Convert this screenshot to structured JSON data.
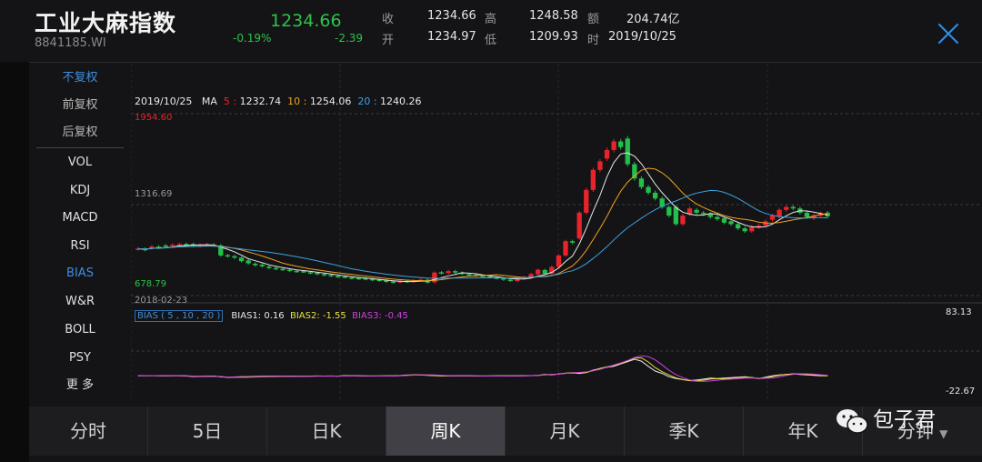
{
  "header": {
    "title": "工业大麻指数",
    "code": "8841185.WI",
    "price": "1234.66",
    "change_pct": "-0.19%",
    "change": "-2.39",
    "quotes": [
      {
        "label": "收",
        "value": "1234.66"
      },
      {
        "label": "开",
        "value": "1234.97"
      },
      {
        "label": "高",
        "value": "1248.58"
      },
      {
        "label": "低",
        "value": "1209.93"
      },
      {
        "label": "额",
        "value": "204.74亿"
      },
      {
        "label": "时",
        "value": "2019/10/25"
      }
    ]
  },
  "sidebar": {
    "items": [
      {
        "label": "不复权",
        "active": true
      },
      {
        "label": "前复权"
      },
      {
        "label": "后复权"
      },
      {
        "label": "VOL"
      },
      {
        "label": "KDJ"
      },
      {
        "label": "MACD"
      },
      {
        "label": "RSI"
      },
      {
        "label": "BIAS",
        "active": true
      },
      {
        "label": "W&R"
      },
      {
        "label": "BOLL"
      },
      {
        "label": "PSY"
      },
      {
        "label": "更 多"
      }
    ]
  },
  "ma_legend": {
    "date": "2019/10/25",
    "ma": "MA",
    "ma5_label": "5 :",
    "ma5": "1232.74",
    "ma10_label": "10 :",
    "ma10": "1254.06",
    "ma20_label": "20 :",
    "ma20": "1240.26"
  },
  "axis_labels": {
    "high": "1954.60",
    "mid": "1316.69",
    "low": "678.79",
    "start_date": "2018-02-23",
    "bias_top": "83.13",
    "bias_bottom": "-22.67"
  },
  "bias_legend": {
    "box": "BIAS ( 5 , 10 , 20 )",
    "bias1": "BIAS1: 0.16",
    "bias2": "BIAS2: -1.55",
    "bias3": "BIAS3: -0.45"
  },
  "tabs": [
    {
      "label": "分时"
    },
    {
      "label": "5日"
    },
    {
      "label": "日K"
    },
    {
      "label": "周K",
      "active": true
    },
    {
      "label": "月K"
    },
    {
      "label": "季K"
    },
    {
      "label": "年K"
    },
    {
      "label": "分钟"
    }
  ],
  "watermark": "包子君",
  "colors": {
    "up": "#e8232a",
    "down": "#22c04b",
    "ma5": "#e6e6e6",
    "ma10": "#f0a020",
    "ma20": "#3ba3e0",
    "accent": "#2f8fe8",
    "bias1": "#e8e8e8",
    "bias2": "#e6e040",
    "bias3": "#d040e0"
  },
  "chart_data": {
    "type": "candlestick",
    "y_range": [
      678.79,
      1954.6
    ],
    "candles": [
      [
        1005,
        1008
      ],
      [
        1006,
        1000
      ],
      [
        1012,
        1022
      ],
      [
        1022,
        1016
      ],
      [
        1030,
        1024
      ],
      [
        1028,
        1035
      ],
      [
        1035,
        1040
      ],
      [
        1040,
        1036
      ],
      [
        1040,
        1028
      ],
      [
        1028,
        1034
      ],
      [
        1032,
        1038
      ],
      [
        1036,
        1030
      ],
      [
        1030,
        960
      ],
      [
        962,
        955
      ],
      [
        955,
        945
      ],
      [
        945,
        920
      ],
      [
        925,
        905
      ],
      [
        902,
        892
      ],
      [
        895,
        884
      ],
      [
        882,
        872
      ],
      [
        872,
        866
      ],
      [
        866,
        860
      ],
      [
        860,
        852
      ],
      [
        852,
        848
      ],
      [
        850,
        845
      ],
      [
        842,
        836
      ],
      [
        838,
        830
      ],
      [
        830,
        822
      ],
      [
        824,
        816
      ],
      [
        816,
        810
      ],
      [
        812,
        808
      ],
      [
        805,
        800
      ],
      [
        802,
        796
      ],
      [
        800,
        794
      ],
      [
        795,
        788
      ],
      [
        790,
        784
      ],
      [
        786,
        775
      ],
      [
        778,
        770
      ],
      [
        772,
        780
      ],
      [
        782,
        776
      ],
      [
        776,
        785
      ],
      [
        786,
        790
      ],
      [
        790,
        770
      ],
      [
        772,
        840
      ],
      [
        842,
        836
      ],
      [
        836,
        850
      ],
      [
        850,
        840
      ],
      [
        840,
        830
      ],
      [
        830,
        822
      ],
      [
        824,
        818
      ],
      [
        818,
        812
      ],
      [
        812,
        806
      ],
      [
        806,
        800
      ],
      [
        800,
        790
      ],
      [
        790,
        782
      ],
      [
        780,
        798
      ],
      [
        798,
        808
      ],
      [
        806,
        830
      ],
      [
        828,
        860
      ],
      [
        858,
        830
      ],
      [
        832,
        880
      ],
      [
        880,
        960
      ],
      [
        960,
        1060
      ],
      [
        1060,
        1050
      ],
      [
        1080,
        1260
      ],
      [
        1260,
        1420
      ],
      [
        1420,
        1560
      ],
      [
        1560,
        1620
      ],
      [
        1640,
        1700
      ],
      [
        1700,
        1760
      ],
      [
        1760,
        1720
      ],
      [
        1780,
        1600
      ],
      [
        1600,
        1500
      ],
      [
        1500,
        1440
      ],
      [
        1440,
        1400
      ],
      [
        1400,
        1360
      ],
      [
        1360,
        1300
      ],
      [
        1300,
        1240
      ],
      [
        1300,
        1180
      ],
      [
        1180,
        1240
      ],
      [
        1250,
        1290
      ],
      [
        1280,
        1260
      ],
      [
        1260,
        1250
      ],
      [
        1250,
        1230
      ],
      [
        1230,
        1215
      ],
      [
        1220,
        1190
      ],
      [
        1200,
        1180
      ],
      [
        1180,
        1150
      ],
      [
        1150,
        1130
      ],
      [
        1130,
        1160
      ],
      [
        1160,
        1170
      ],
      [
        1170,
        1200
      ],
      [
        1210,
        1240
      ],
      [
        1230,
        1280
      ],
      [
        1280,
        1300
      ],
      [
        1300,
        1290
      ],
      [
        1290,
        1260
      ],
      [
        1260,
        1230
      ],
      [
        1220,
        1240
      ],
      [
        1240,
        1255
      ],
      [
        1260,
        1235
      ]
    ],
    "bias1": [
      0.2,
      0.3,
      0.5,
      0.1,
      0.0,
      0.3,
      0.2,
      -0.5,
      -1.5,
      -1.0,
      -0.8,
      -0.6,
      -2.5,
      -3.0,
      -2.5,
      -2.0,
      -1.8,
      -1.5,
      -1.2,
      -1.0,
      -1.1,
      -0.9,
      -0.8,
      -0.6,
      -0.7,
      -0.5,
      -0.4,
      -0.6,
      -0.3,
      -0.8,
      0.5,
      0.3,
      -0.2,
      -0.5,
      -0.4,
      -0.3,
      -0.2,
      0.1,
      0.5,
      1.5,
      2.0,
      1.5,
      1.0,
      0.5,
      -0.3,
      -0.1,
      0.0,
      0.1,
      -0.2,
      -0.5,
      -0.4,
      -0.3,
      -0.2,
      -0.1,
      0.0,
      0.1,
      0.3,
      0.5,
      1.0,
      3.0,
      2.0,
      4.0,
      5.5,
      6.0,
      5.0,
      7.0,
      12,
      15,
      18,
      20,
      25,
      30,
      35,
      31,
      20,
      10,
      5,
      -2,
      -6,
      -8,
      -10,
      -9,
      -7,
      -5,
      -6,
      -5,
      -4,
      -3,
      -2,
      -4,
      -6,
      -3,
      0,
      2,
      3,
      4,
      3,
      2,
      1,
      0,
      0.16
    ]
  }
}
